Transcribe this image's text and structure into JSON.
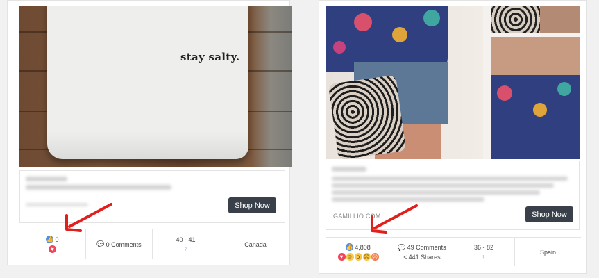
{
  "posts": [
    {
      "image_text": "stay salty.",
      "ad": {
        "cta": "Shop Now"
      },
      "stats": {
        "likes": "0",
        "comments": "0 Comments",
        "age_range": "40 - 41",
        "country": "Canada"
      }
    },
    {
      "ad": {
        "domain": "GAMILLIO.COM",
        "cta": "Shop Now"
      },
      "stats": {
        "likes": "4,808",
        "comments": "49 Comments",
        "shares": "441 Shares",
        "age_range": "36 - 82",
        "country": "Spain"
      }
    }
  ],
  "icons": {
    "like": "thumbs-up-icon",
    "love": "heart-icon",
    "comment": "speech-bubble-icon",
    "share": "share-icon",
    "gender": "female-icon"
  },
  "colors": {
    "like": "#4d8ef0",
    "love": "#f0435c",
    "cta_bg": "#394049",
    "arrow": "#e0201c",
    "gender": "#c468d4"
  }
}
